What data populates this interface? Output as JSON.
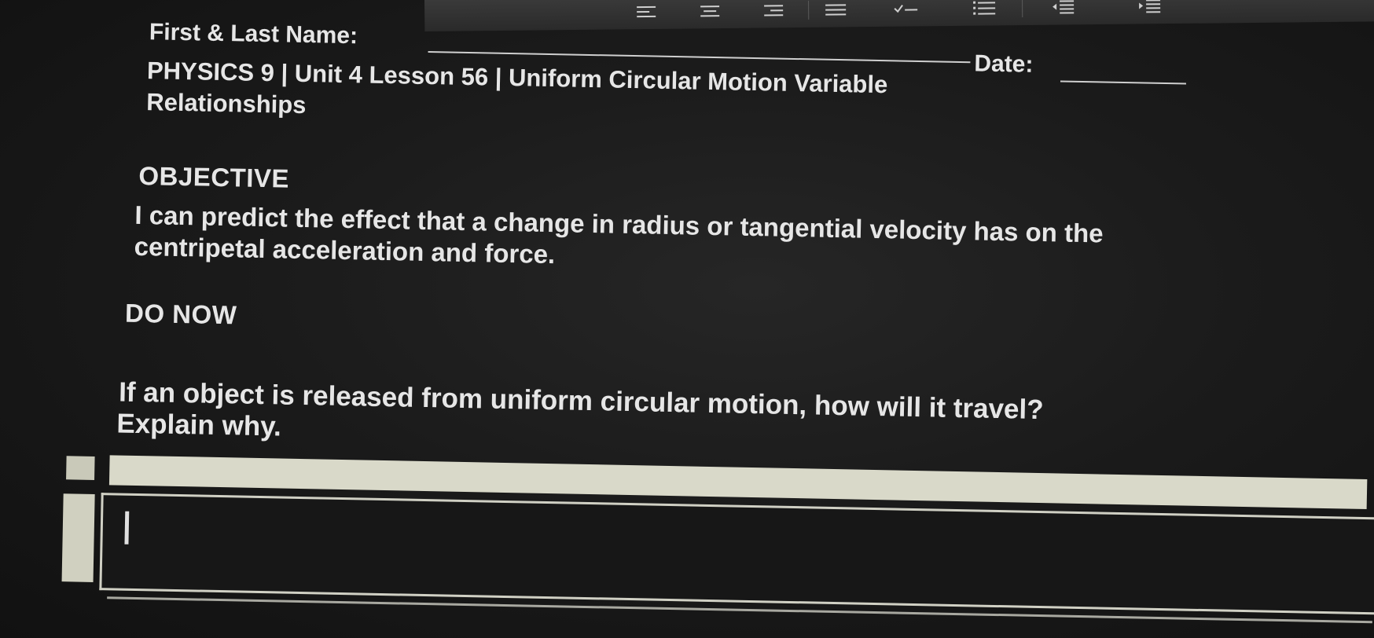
{
  "header": {
    "name_label": "First & Last Name:",
    "date_label": "Date:",
    "title_line1": "PHYSICS 9 | Unit 4 Lesson 56 | Uniform Circular Motion Variable",
    "title_line2": "Relationships"
  },
  "objective": {
    "heading": "OBJECTIVE",
    "text_line1": "I can predict the effect that a change in radius or tangential velocity has on the",
    "text_line2": "centripetal acceleration and force."
  },
  "do_now": {
    "heading": "DO NOW",
    "question_line1": "If an object is released from uniform circular motion, how will it travel?",
    "question_line2": "Explain why."
  },
  "answer": {
    "value": ""
  },
  "toolbar": {
    "icons": [
      "align-left-icon",
      "align-center-icon",
      "align-right-icon",
      "align-justify-icon",
      "checklist-icon",
      "numbered-list-icon",
      "decrease-indent-icon",
      "increase-indent-icon"
    ]
  },
  "colors": {
    "background": "#1b1b1b",
    "text": "#e6e6e6",
    "answer_bar": "#d9d9c9"
  }
}
